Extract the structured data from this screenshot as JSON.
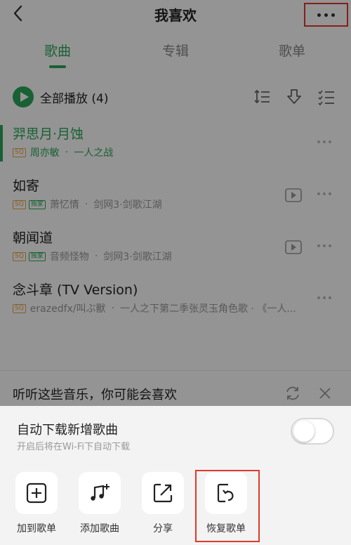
{
  "header": {
    "title": "我喜欢"
  },
  "tabs": [
    {
      "label": "歌曲",
      "active": true
    },
    {
      "label": "专辑",
      "active": false
    },
    {
      "label": "歌单",
      "active": false
    }
  ],
  "play_all": {
    "label": "全部播放",
    "count": "(4)"
  },
  "songs": [
    {
      "title": "羿思月·月蚀",
      "badges": [
        "SQ"
      ],
      "artist": "周亦敏",
      "album": "一人之战",
      "playing": true,
      "has_mv": false
    },
    {
      "title": "如寄",
      "badges": [
        "SQ",
        "独家"
      ],
      "artist": "萧忆情",
      "album": "剑网3·剑歌江湖",
      "playing": false,
      "has_mv": true
    },
    {
      "title": "朝闻道",
      "badges": [
        "SQ",
        "独家"
      ],
      "artist": "音频怪物",
      "album": "剑网3·剑歌江湖",
      "playing": false,
      "has_mv": true
    },
    {
      "title": "念斗章 (TV Version)",
      "badges": [
        "SQ"
      ],
      "artist": "erazedfx/叫ぶ獸",
      "album": "一人之下第二季张灵玉角色歌 · 《一人...",
      "playing": false,
      "has_mv": false
    }
  ],
  "separator": "·",
  "recommend": {
    "label": "听听这些音乐，你可能会喜欢"
  },
  "sheet": {
    "auto_download_title": "自动下载新增歌曲",
    "auto_download_subtitle": "开启后将在Wi-Fi下自动下载",
    "auto_download_enabled": false,
    "actions": [
      {
        "label": "加到歌单",
        "icon": "add-box-icon"
      },
      {
        "label": "添加歌曲",
        "icon": "add-music-icon"
      },
      {
        "label": "分享",
        "icon": "share-icon"
      },
      {
        "label": "恢复歌单",
        "icon": "restore-icon"
      }
    ]
  },
  "colors": {
    "accent": "#2ba85a",
    "highlight": "#e0392b",
    "sq_badge": "#e8a344"
  }
}
